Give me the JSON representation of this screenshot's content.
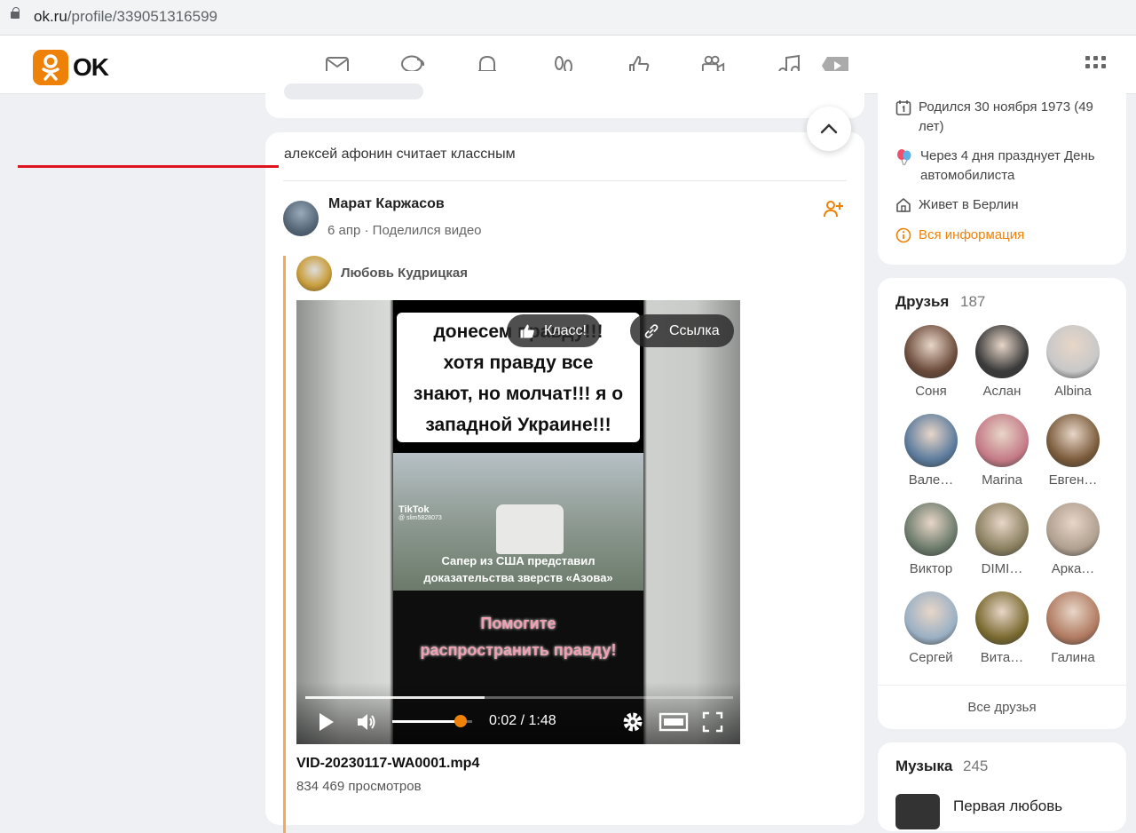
{
  "browser": {
    "url_host": "ok.ru",
    "url_path": "/profile/339051316599"
  },
  "header": {
    "logo_text": "OK",
    "brand_color": "#ee8208"
  },
  "feed": {
    "event_text": "алексей афонин считает классным",
    "post": {
      "author": "Марат Каржасов",
      "date": "6 апр",
      "action": "Поделился видео",
      "original_author": "Любовь Кудрицкая",
      "video": {
        "caption_lines": [
          "донесем правду!!!",
          "хотя правду все",
          "знают, но молчат!!! я о",
          "западной Украине!!!"
        ],
        "scene_brand": "TikTok",
        "scene_handle": "@ slim5828073",
        "scene_text_lines": [
          "Сапер из США представил",
          "доказательства зверств «Азова»"
        ],
        "help_lines": [
          "Помогите",
          "распространить правду!"
        ],
        "btn_like": "Класс!",
        "btn_link": "Ссылка",
        "time": "0:02 / 1:48",
        "progress": 0.42,
        "volume": 0.85
      },
      "video_title": "VID-20230117-WA0001.mp4",
      "views": "834 469 просмотров"
    }
  },
  "profile_info": {
    "birth": "Родился 30 ноября 1973 (49 лет)",
    "holiday": "Через 4 дня празднует День автомобилиста",
    "lives": "Живет в Берлин",
    "all_info": "Вся информация"
  },
  "friends": {
    "title": "Друзья",
    "count": "187",
    "items": [
      {
        "name": "Соня",
        "color": "#6b4a3a"
      },
      {
        "name": "Аслан",
        "color": "#3a3a3a"
      },
      {
        "name": "Albina",
        "color": "#c8c8c8"
      },
      {
        "name": "Вале…",
        "color": "#5a7a9c"
      },
      {
        "name": "Marina",
        "color": "#c47a86"
      },
      {
        "name": "Евген…",
        "color": "#7a5a3a"
      },
      {
        "name": "Виктор",
        "color": "#6a7a6a"
      },
      {
        "name": "DIMI…",
        "color": "#8a8060"
      },
      {
        "name": "Арка…",
        "color": "#b0a090"
      },
      {
        "name": "Сергей",
        "color": "#9ab0c4"
      },
      {
        "name": "Вита…",
        "color": "#7a6a30"
      },
      {
        "name": "Галина",
        "color": "#b07a60"
      }
    ],
    "all_label": "Все друзья"
  },
  "music": {
    "title": "Музыка",
    "count": "245",
    "track": "Первая любовь"
  }
}
